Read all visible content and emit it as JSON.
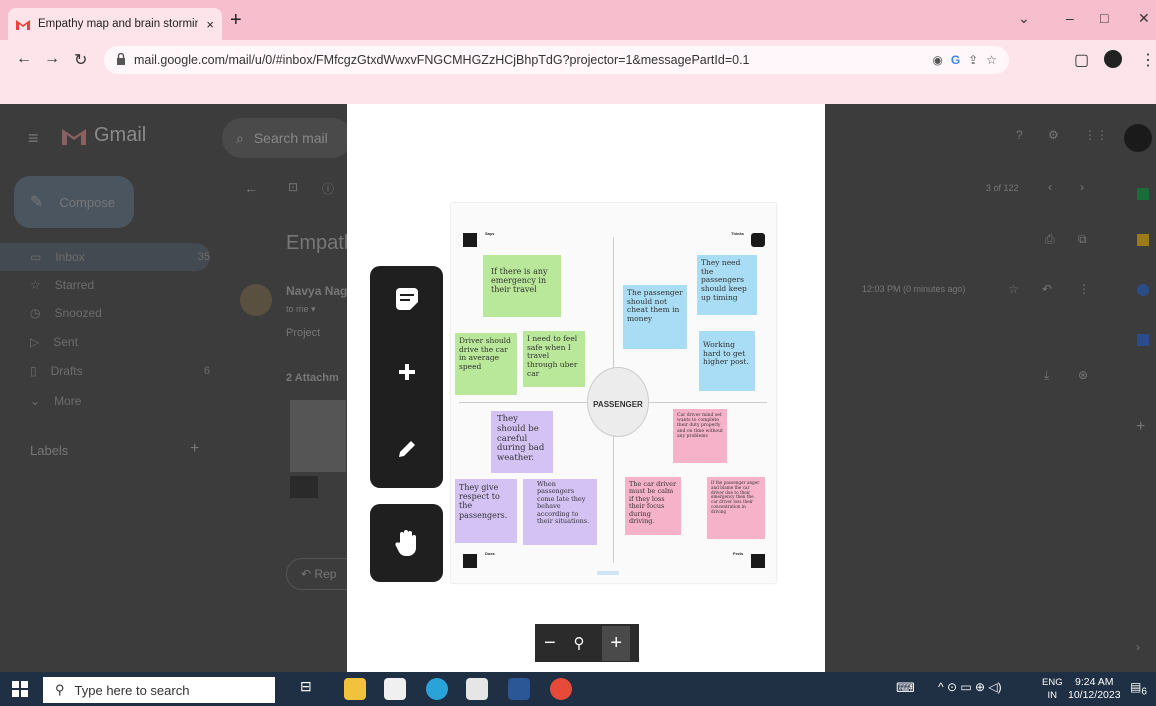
{
  "browser": {
    "tab_title": "Empathy map and brain stormin",
    "tab_close": "×",
    "new_tab": "+",
    "url": "mail.google.com/mail/u/0/#inbox/FMfcgzGtxdWwxvFNGCMHGZzHCjBhpTdG?projector=1&messagePartId=0.1",
    "win": [
      "⌄",
      "–",
      "□",
      "✕"
    ]
  },
  "gmail": {
    "logo_text": "Gmail",
    "search_placeholder": "Search mail",
    "compose": "Compose",
    "nav": [
      {
        "label": "Inbox",
        "count": "35"
      },
      {
        "label": "Starred",
        "count": ""
      },
      {
        "label": "Snoozed",
        "count": ""
      },
      {
        "label": "Sent",
        "count": ""
      },
      {
        "label": "Drafts",
        "count": "6"
      },
      {
        "label": "More",
        "count": ""
      }
    ],
    "labels_heading": "Labels",
    "subject_partial": "Empath",
    "sender_partial": "Navya Nag",
    "to_me": "to me ▾",
    "body_text": "Project",
    "attachments": "2 Attachm",
    "reply_partial": "Rep",
    "pager": "3 of 122",
    "time": "12:03 PM (0 minutes ago)"
  },
  "board": {
    "center": "PASSENGER",
    "quadrants": {
      "says": "Says",
      "thinks": "Thinks",
      "does": "Does",
      "feels": "Feels"
    },
    "notes": {
      "n1": "If there is any emergency in their travel",
      "n2": "Driver should drive the car in average speed",
      "n3": "I need to feel safe when I travel through uber car",
      "n4": "The passenger should not cheat them in money",
      "n5": "They need the passengers should keep up timing",
      "n6": "Working hard to get higher post.",
      "n7": "They should be careful during bad weather.",
      "n8": "They give respect to the passengers.",
      "n9": "When passengers come late they behave according to their situations.",
      "n10": "Car driver mind set wants to complete their duty properly and on time without any problems",
      "n11": "The car driver must be calm if they loss their focus during driving.",
      "n12": "If the passenger anger and blame the car driver due to their emergency then the car driver loss their concentration in driving"
    }
  },
  "viewer": {
    "zoom_minus": "−",
    "zoom_plus": "+"
  },
  "taskbar": {
    "search_placeholder": "Type here to search",
    "lang": "ENG",
    "region": "IN",
    "time": "9:24 AM",
    "date": "10/12/2023",
    "notif": "6"
  }
}
